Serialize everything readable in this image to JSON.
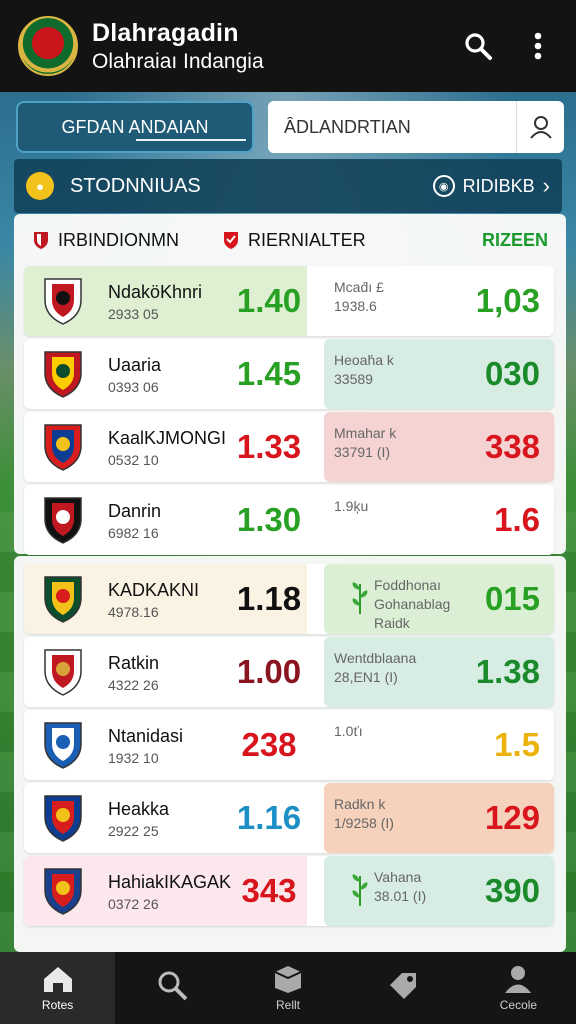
{
  "header": {
    "title": "Dlahragadin",
    "subtitle": "Olahraiaı Indangia",
    "logo_icon": "club-crest-logo",
    "search_icon": "search-icon",
    "menu_icon": "kebab-menu-icon"
  },
  "controls": {
    "tab_label": "GFDAN ANDAIAN",
    "search_placeholder": "ÂDLANDRTIAN",
    "search_button_icon": "user-search-icon"
  },
  "standings": {
    "label": "STODNNIUAS",
    "link_label": "RIDIBKB"
  },
  "columns": {
    "teams": "IRBINDIONMN",
    "result": "RIERNIALTER",
    "right": "RIZEEN"
  },
  "rows": [
    {
      "name": "NdaköKhnri",
      "code": "2933 05",
      "odd1": "1.40",
      "note": "Mcad́ı £\n1938.6",
      "odd2": "1,03",
      "odd1_color": "#27a023",
      "odd2_color": "#27a023",
      "left_bg": "#dff0d2",
      "right_bg": "#ffffff"
    },
    {
      "name": "Uaaria",
      "code": "0393 06",
      "odd1": "1.45",
      "note": "Heoah́a k\n33589",
      "odd2": "030",
      "odd1_color": "#27a023",
      "odd2_color": "#1a8a2a",
      "left_bg": "#ffffff",
      "right_bg": "#d7ece3"
    },
    {
      "name": "KaalKJMONGI",
      "code": "0532 10",
      "odd1": "1.33",
      "note": "Mmahar k\n33791 (I)",
      "odd2": "338",
      "odd1_color": "#d8151d",
      "odd2_color": "#d8151d",
      "left_bg": "#ffffff",
      "right_bg": "#f4d3d2"
    },
    {
      "name": "Danrin",
      "code": "6982 16",
      "odd1": "1.30",
      "note": "1.9ķu",
      "odd2": "1.6",
      "odd1_color": "#27a023",
      "odd2_color": "#d8151d",
      "left_bg": "#ffffff",
      "right_bg": "#ffffff"
    }
  ],
  "rows2": [
    {
      "name": "KADKAKNI",
      "code": "4978.16",
      "odd1": "1.18",
      "note": "Foddhonaı\nGohanablag\nRaidk",
      "odd2": "015",
      "odd1_color": "#111111",
      "odd2_color": "#27a023",
      "left_bg": "#faf3e4",
      "right_bg": "#dbefd5",
      "leaf": true
    },
    {
      "name": "Ratkin",
      "code": "4322 26",
      "odd1": "1.00",
      "note": "Wentdblaana\n28,EN1 (I)",
      "odd2": "1.38",
      "odd1_color": "#8a1520",
      "odd2_color": "#1a8a2a",
      "left_bg": "#ffffff",
      "right_bg": "#d7ece3"
    },
    {
      "name": "Ntanidasi",
      "code": "1932 10",
      "odd1": "238",
      "note": "1.0ťı",
      "odd2": "1.5",
      "odd1_color": "#d8151d",
      "odd2_color": "#eab20b",
      "left_bg": "#ffffff",
      "right_bg": "#ffffff"
    },
    {
      "name": "Heakka",
      "code": "2922 25",
      "odd1": "1.16",
      "note": "Radkn k\n1/9258 (I)",
      "odd2": "129",
      "odd1_color": "#1c8fc7",
      "odd2_color": "#d8151d",
      "left_bg": "#ffffff",
      "right_bg": "#f6d2bc"
    },
    {
      "name": "HahiakIKAGAK",
      "code": "0372 26",
      "odd1": "343",
      "note": "Vahana\n38.01 (I)",
      "odd2": "390",
      "odd1_color": "#d8151d",
      "odd2_color": "#1a8a2a",
      "left_bg": "#fce8ec",
      "right_bg": "#d7ece3",
      "leaf": true
    }
  ],
  "bottom_nav": [
    {
      "label": "Rotes",
      "icon": "home-icon",
      "active": true
    },
    {
      "label": "",
      "icon": "search-person-icon",
      "active": false
    },
    {
      "label": "Rellt",
      "icon": "box-icon",
      "active": false
    },
    {
      "label": "",
      "icon": "tag-icon",
      "active": false
    },
    {
      "label": "Cecole",
      "icon": "profile-icon",
      "active": false
    }
  ]
}
